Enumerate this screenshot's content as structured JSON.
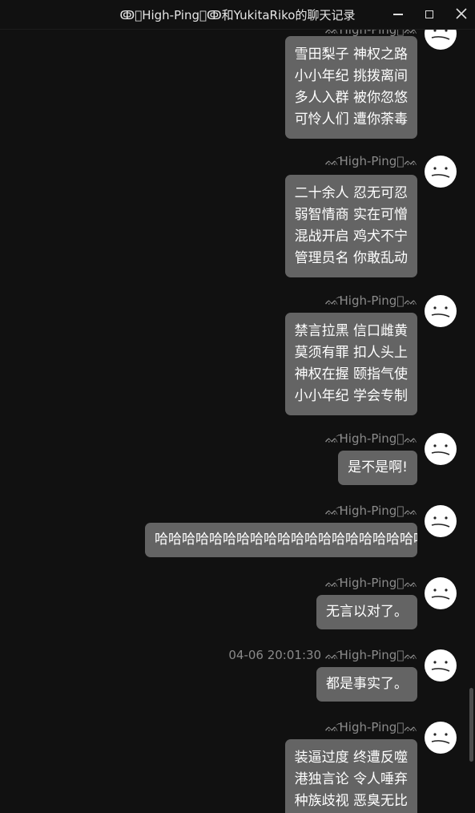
{
  "window": {
    "title": "ↂ᷍High-Ping᷍ↂ和YukitaRiko的聊天记录",
    "minimize_icon": "minimize-icon",
    "maximize_icon": "maximize-icon",
    "close_icon": "close-icon"
  },
  "colors": {
    "background": "#111111",
    "bubble": "#646464",
    "meta_text": "#8a8a8a"
  },
  "messages": [
    {
      "sender": "ᨐ᷍High-Ping᷍ᨐ",
      "time": "",
      "lines": [
        "雪田梨子 神权之路",
        "小小年纪 挑拨离间",
        "多人入群 被你忽悠",
        "可怜人们 遭你荼毒"
      ]
    },
    {
      "sender": "ᨐ᷍High-Ping᷍ᨐ",
      "time": "",
      "lines": [
        "二十余人 忍无可忍",
        "弱智情商 实在可憎",
        "混战开启 鸡犬不宁",
        "管理员名 你敢乱动"
      ]
    },
    {
      "sender": "ᨐ᷍High-Ping᷍ᨐ",
      "time": "",
      "lines": [
        "禁言拉黑 信口雌黄",
        "莫须有罪 扣人头上",
        "神权在握 颐指气使",
        "小小年纪 学会专制"
      ]
    },
    {
      "sender": "ᨐ᷍High-Ping᷍ᨐ",
      "time": "",
      "lines": [
        "是不是啊!"
      ]
    },
    {
      "sender": "ᨐ᷍High-Ping᷍ᨐ",
      "time": "",
      "lines": [
        "哈哈哈哈哈哈哈哈哈哈哈哈哈哈哈哈哈哈哈哈"
      ]
    },
    {
      "sender": "ᨐ᷍High-Ping᷍ᨐ",
      "time": "",
      "lines": [
        "无言以对了。"
      ]
    },
    {
      "sender": "ᨐ᷍High-Ping᷍ᨐ",
      "time": "04-06 20:01:30",
      "lines": [
        "都是事实了。"
      ]
    },
    {
      "sender": "ᨐ᷍High-Ping᷍ᨐ",
      "time": "",
      "lines": [
        "装逼过度 终遭反噬",
        "港独言论 令人唾弃",
        "种族歧视 恶臭无比"
      ]
    }
  ]
}
